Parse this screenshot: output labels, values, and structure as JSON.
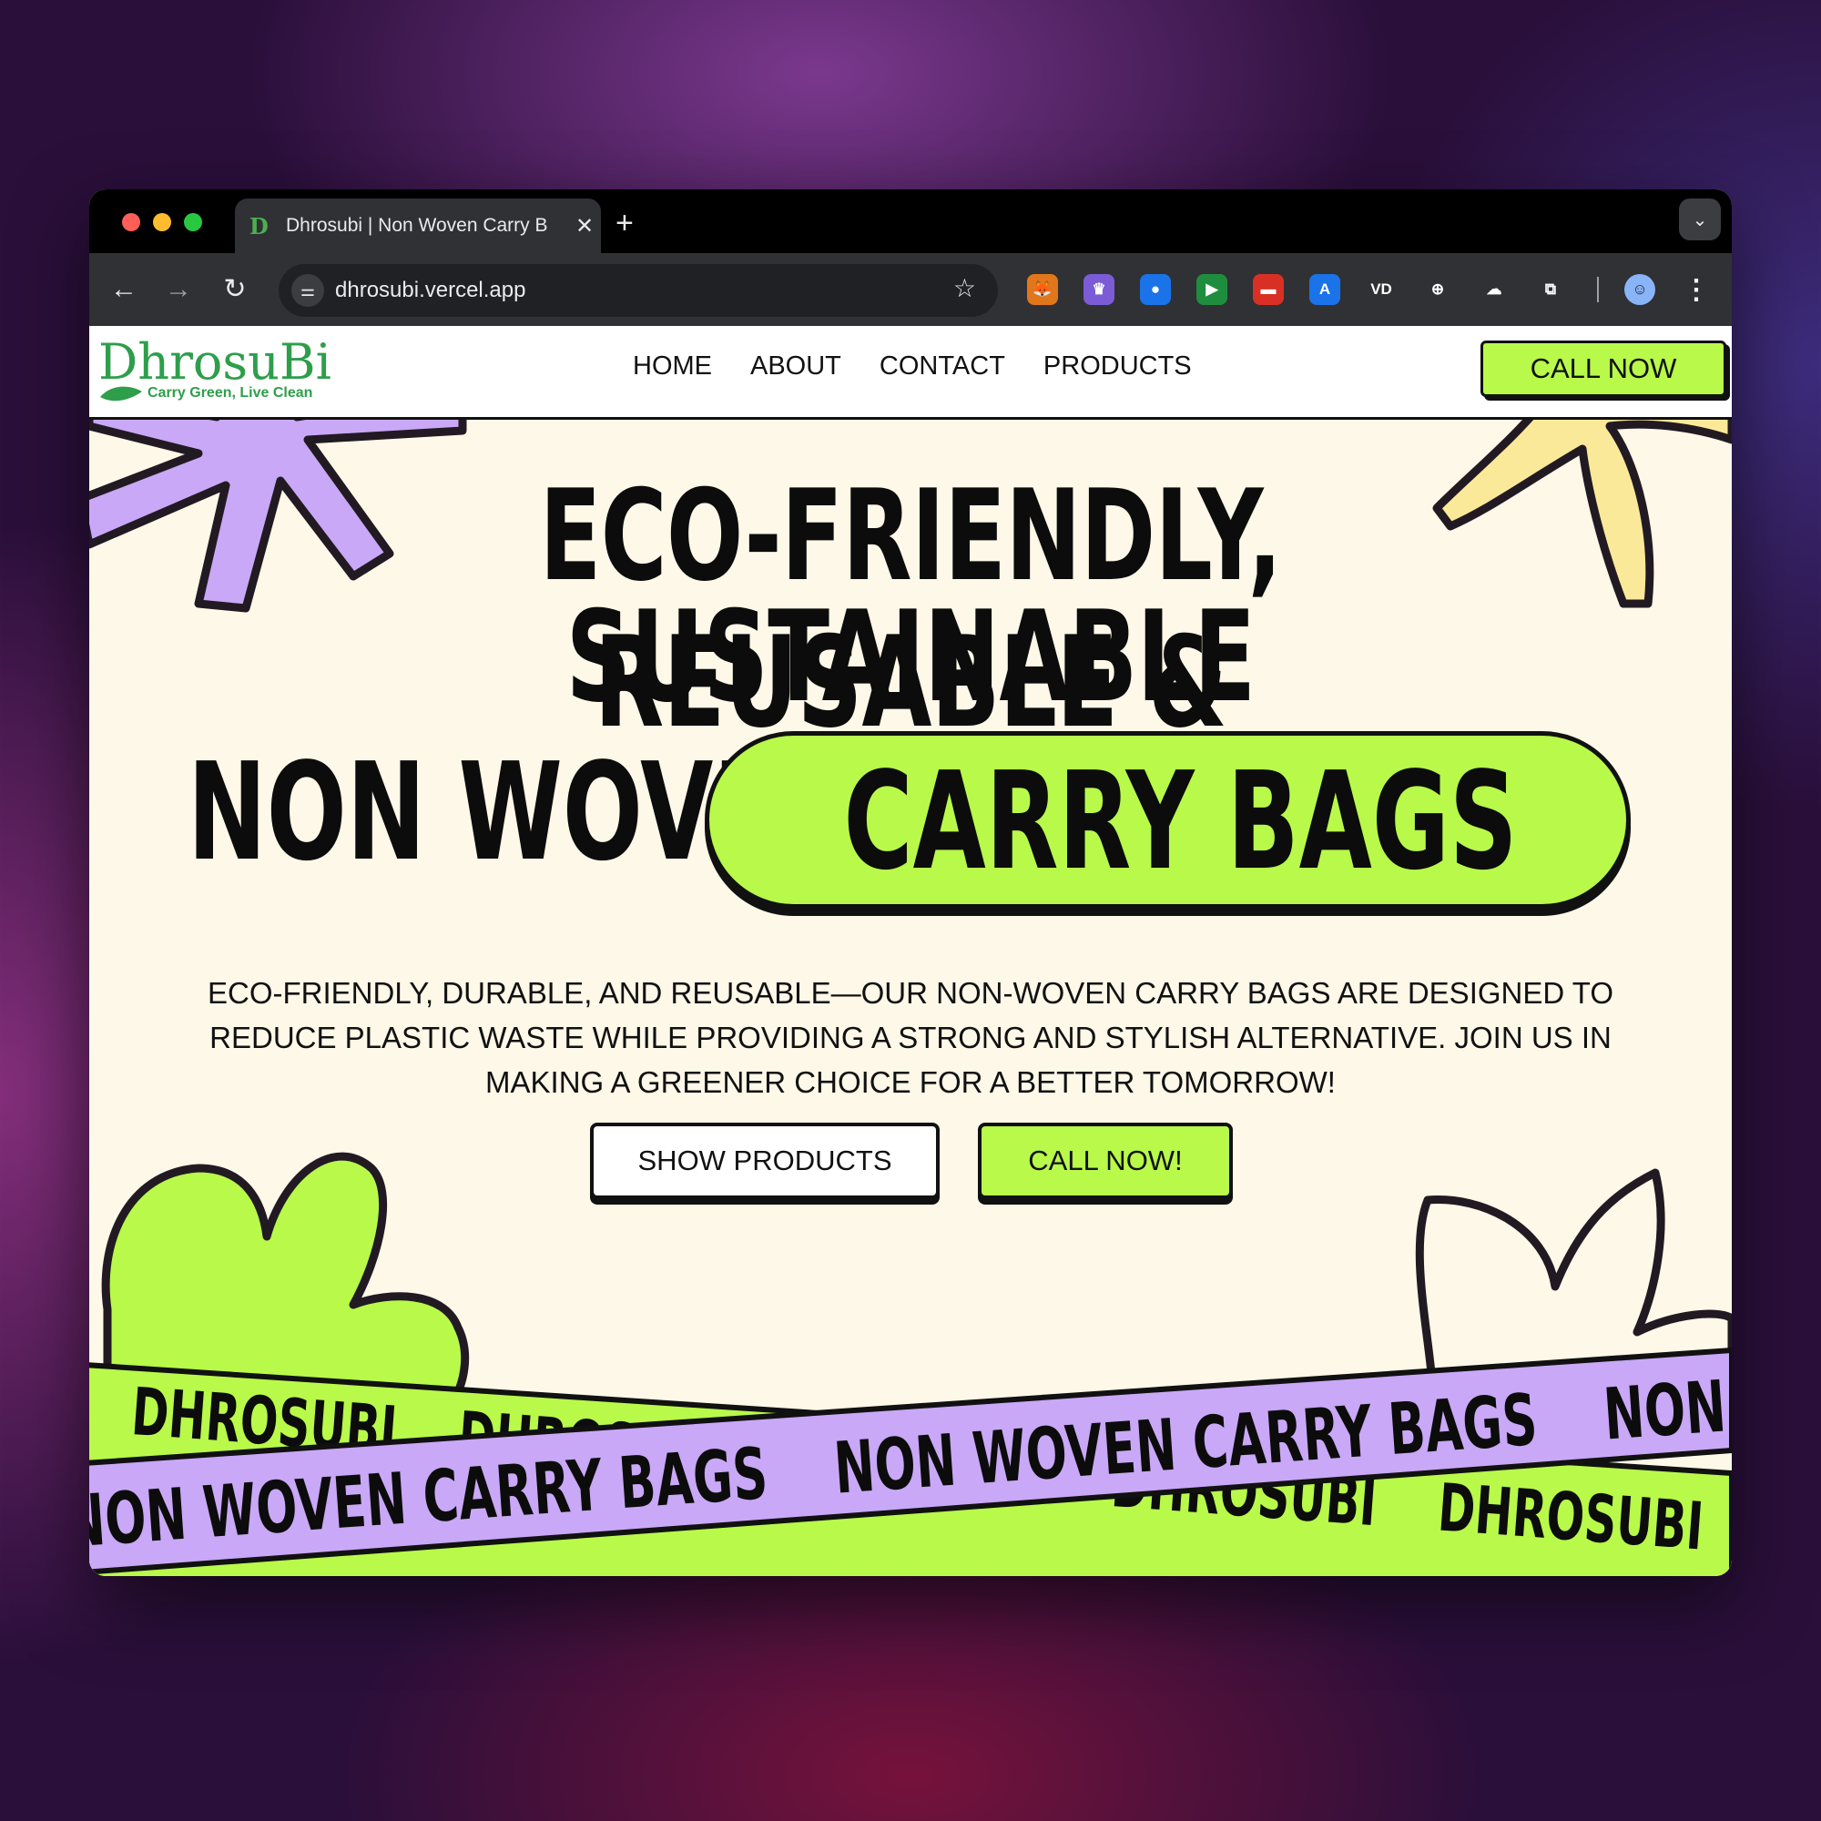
{
  "browser": {
    "tab_title": "Dhrosubi | Non Woven Carry B",
    "tab_favicon": "D",
    "new_tab_symbol": "+",
    "close_symbol": "✕",
    "url": "dhrosubi.vercel.app",
    "extensions": [
      {
        "name": "metamask-fox-icon",
        "color": "#e2761b",
        "glyph": "🦊"
      },
      {
        "name": "crown-extension-icon",
        "color": "#7b5cd6",
        "glyph": "♛"
      },
      {
        "name": "globe-extension-icon",
        "color": "#1a73e8",
        "glyph": "●"
      },
      {
        "name": "play-extension-icon",
        "color": "#1e8e3e",
        "glyph": "▶"
      },
      {
        "name": "toolbox-extension-icon",
        "color": "#d93025",
        "glyph": "▬"
      },
      {
        "name": "translate-extension-icon",
        "color": "#1a73e8",
        "glyph": "A"
      },
      {
        "name": "vd-extension-icon",
        "color": "#303134",
        "glyph": "VD"
      },
      {
        "name": "download-extension-icon",
        "color": "#303134",
        "glyph": "⊕"
      },
      {
        "name": "cloud-extension-icon",
        "color": "#303134",
        "glyph": "☁"
      },
      {
        "name": "puzzle-extensions-icon",
        "color": "#303134",
        "glyph": "⧉"
      }
    ]
  },
  "site": {
    "logo_text": "DhrosuBi",
    "logo_tagline": "Carry Green, Live Clean",
    "nav": [
      "HOME",
      "ABOUT",
      "CONTACT",
      "PRODUCTS"
    ],
    "header_cta": "CALL NOW",
    "headline_line1": "ECO-FRIENDLY, REUSABLE &",
    "headline_line2": "SUSTAINABLE",
    "subheadline_left": "NON WOVEN",
    "subheadline_pill": "CARRY BAGS",
    "description": "ECO-FRIENDLY, DURABLE, AND REUSABLE—OUR NON-WOVEN CARRY BAGS ARE DESIGNED TO REDUCE PLASTIC WASTE WHILE PROVIDING A STRONG AND STYLISH ALTERNATIVE. JOIN US IN MAKING A GREENER CHOICE FOR A BETTER TOMORROW!",
    "btn_show_products": "SHOW PRODUCTS",
    "btn_call": "CALL NOW!",
    "marquee_green_text": "DHROSUBI",
    "marquee_purple_text": "NON WOVEN CARRY BAGS"
  },
  "colors": {
    "accent_green": "#b8f94a",
    "accent_purple": "#c9a8f7",
    "accent_yellow": "#fbe99a",
    "page_bg": "#fdf8e8",
    "ink": "#111111"
  }
}
